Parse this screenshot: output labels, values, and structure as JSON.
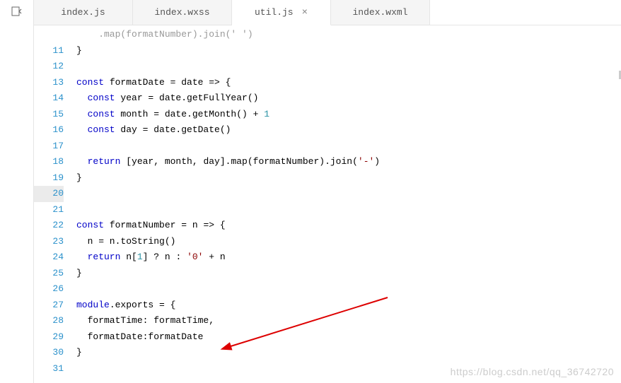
{
  "tabs": [
    {
      "label": "index.js",
      "active": false
    },
    {
      "label": "index.wxss",
      "active": false
    },
    {
      "label": "util.js",
      "active": true
    },
    {
      "label": "index.wxml",
      "active": false
    }
  ],
  "line_numbers": [
    "11",
    "12",
    "13",
    "14",
    "15",
    "16",
    "17",
    "18",
    "19",
    "20",
    "21",
    "22",
    "23",
    "24",
    "25",
    "26",
    "27",
    "28",
    "29",
    "30",
    "31"
  ],
  "code": {
    "l_partial": "    .map(formatNumber).join(' ')",
    "l11": "}",
    "l12": "",
    "l13_1": "const",
    "l13_2": " formatDate = date => {",
    "l14_1": "  const",
    "l14_2": " year = date.getFullYear()",
    "l15_1": "  const",
    "l15_2": " month = date.getMonth() + ",
    "l15_3": "1",
    "l16_1": "  const",
    "l16_2": " day = date.getDate()",
    "l17": "",
    "l18_1": "  return",
    "l18_2": " [year, month, day].map(formatNumber).join(",
    "l18_3": "'-'",
    "l18_4": ")",
    "l19": "}",
    "l20": "",
    "l21": "",
    "l22_1": "const",
    "l22_2": " formatNumber = n => {",
    "l23": "  n = n.toString()",
    "l24_1": "  return",
    "l24_2": " n[",
    "l24_3": "1",
    "l24_4": "] ? n : ",
    "l24_5": "'0'",
    "l24_6": " + n",
    "l25": "}",
    "l26": "",
    "l27_1": "module",
    "l27_2": ".exports = {",
    "l28": "  formatTime: formatTime,",
    "l29": "  formatDate:formatDate",
    "l30": "}",
    "l31": ""
  },
  "watermark": "https://blog.csdn.net/qq_36742720"
}
